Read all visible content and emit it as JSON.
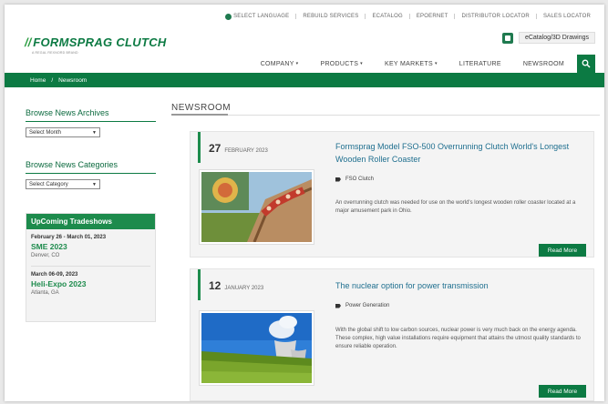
{
  "utility": {
    "items": [
      "SELECT LANGUAGE",
      "REBUILD SERVICES",
      "ECATALOG",
      "EPOERNET",
      "DISTRIBUTOR LOCATOR",
      "SALES LOCATOR"
    ]
  },
  "brand": {
    "name": "FORMSPRAG CLUTCH",
    "tagline": "A REGAL REXNORD BRAND",
    "accent_color": "#0c7a43"
  },
  "header": {
    "ecatalog_label": "eCatalog/3D Drawings"
  },
  "nav": {
    "items": [
      "COMPANY",
      "PRODUCTS",
      "KEY MARKETS",
      "LITERATURE",
      "NEWSROOM"
    ]
  },
  "breadcrumb": {
    "home": "Home",
    "sep": "/",
    "current": "Newsroom"
  },
  "sidebar": {
    "archives_heading": "Browse News Archives",
    "archives_select": "Select Month",
    "categories_heading": "Browse News Categories",
    "categories_select": "Select Category",
    "tradeshows_heading": "UpComing Tradeshows",
    "events": [
      {
        "date": "February 26 - March 01, 2023",
        "name": "SME 2023",
        "location": "Denver, CO"
      },
      {
        "date": "March 06-09, 2023",
        "name": "Heli-Expo 2023",
        "location": "Atlanta, GA"
      }
    ]
  },
  "newsroom": {
    "heading": "NEWSROOM",
    "articles": [
      {
        "day": "27",
        "month": "FEBRUARY 2023",
        "title": "Formsprag Model FSO-500 Overrunning Clutch World's Longest Wooden Roller Coaster",
        "tag": "FSO Clutch",
        "description": "An overrunning clutch was needed for use on the world's longest wooden roller coaster located at a major amusement park in Ohio.",
        "button": "Read More"
      },
      {
        "day": "12",
        "month": "JANUARY 2023",
        "title": "The nuclear option for power transmission",
        "tag": "Power Generation",
        "description": "With the global shift to low carbon sources, nuclear power is very much back on the energy agenda. These complex, high value installations require equipment that attains the utmost quality standards to ensure reliable operation.",
        "button": "Read More"
      }
    ]
  }
}
